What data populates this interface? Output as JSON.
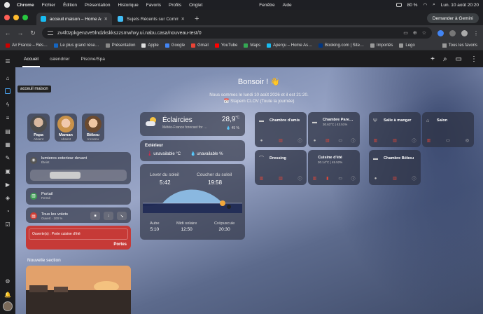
{
  "menubar": {
    "app": "Chrome",
    "items": [
      "Fichier",
      "Édition",
      "Présentation",
      "Historique",
      "Favoris",
      "Profils",
      "Onglet",
      "Fenêtre",
      "Aide"
    ],
    "battery": "80 %",
    "datetime": "Lun. 10 août  20:20"
  },
  "tabs": [
    {
      "label": "acceuil maison – Home Assist",
      "active": true
    },
    {
      "label": "Sujets Récents sur Commun",
      "active": false
    }
  ],
  "gemini_label": "Demander à Gemini",
  "url": "zv4l0zpkgenzve5lndzkskkszzsmwhxy.ui.nabu.casa/nouveau-test/0",
  "bookmarks": [
    "Air France – Rés…",
    "Le plus grand rése…",
    "Présentation",
    "Apple",
    "Google",
    "Gmail",
    "YouTube",
    "Maps",
    "Aperçu – Home As…",
    "Booking.com | Site…",
    "Importés",
    "Lego"
  ],
  "bookmarks_all": "Tous les favoris",
  "ha": {
    "tabs": [
      "Accueil",
      "calendrier",
      "Piscine/Spa"
    ],
    "tooltip": "acceuil maison",
    "greeting": "Bonsoir ! 👋",
    "date_line": "Nous sommes le lundi 10 août 2026 et il est 21:20.",
    "event_line": "📅 Stapem CLOV (Toute la journée)",
    "persons": [
      {
        "name": "Papa",
        "state": "Absent"
      },
      {
        "name": "Maman",
        "state": "Absent"
      },
      {
        "name": "Bébou",
        "state": "Inconnu"
      }
    ],
    "light": {
      "name": "lumieres exterieur devant",
      "state": "Éteint"
    },
    "portail": {
      "name": "Portail",
      "state": "Fermé"
    },
    "volets": {
      "name": "Tous les volets",
      "state": "Ouvert · 100 %"
    },
    "alert": {
      "text": "Ouverte(s) : Porte cuisine d'été",
      "label": "Portes"
    },
    "section_title": "Nouvelle section",
    "weather": {
      "condition": "Éclaircies",
      "source": "Météo-France forecast for …",
      "temp": "28,9",
      "unit": "°C",
      "humidity": "45 %"
    },
    "exterieur": {
      "title": "Extérieur",
      "temp": "unavailable °C",
      "humidity": "unavailable %"
    },
    "sun": {
      "rise_label": "Lever du soleil",
      "rise": "5:42",
      "set_label": "Coucher du soleil",
      "set": "19:58",
      "dawn_label": "Aube",
      "dawn": "5:10",
      "noon_label": "Midi solaire",
      "noon": "12:50",
      "dusk_label": "Crépuscule",
      "dusk": "20:30"
    },
    "rooms": [
      {
        "name": "Chambre d'amis",
        "stat": ""
      },
      {
        "name": "Chambre Pare…",
        "stat": "30.63°C | 43.51%"
      },
      {
        "name": "Dressing",
        "stat": ""
      },
      {
        "name": "Cuisine d'été",
        "stat": "30.14°C | 45.52%"
      },
      {
        "name": "Salle à manger",
        "stat": ""
      },
      {
        "name": "Salon",
        "stat": ""
      },
      {
        "name": "Chambre Bébou",
        "stat": ""
      }
    ]
  }
}
